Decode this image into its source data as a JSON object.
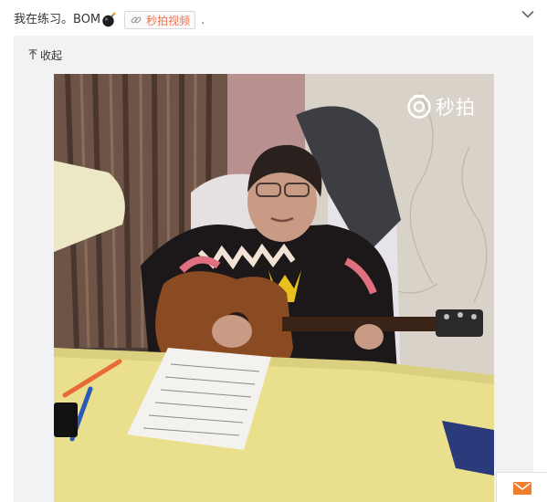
{
  "post": {
    "text": "我在练习。BOM",
    "emoji_icon": "bomb-icon",
    "video_tag_label": "秒拍视频",
    "video_tag_icon": "link-icon",
    "trailing_text": "."
  },
  "header": {
    "expand_icon": "chevron-down-icon"
  },
  "media": {
    "collapse_label": "收起",
    "collapse_icon": "up-arrow-icon",
    "watermark_text": "秒拍",
    "watermark_icon": "camera-icon"
  },
  "floating": {
    "mail_icon": "mail-icon"
  },
  "colors": {
    "accent": "#eb7350",
    "panel_bg": "#f2f2f5",
    "text": "#333333"
  }
}
